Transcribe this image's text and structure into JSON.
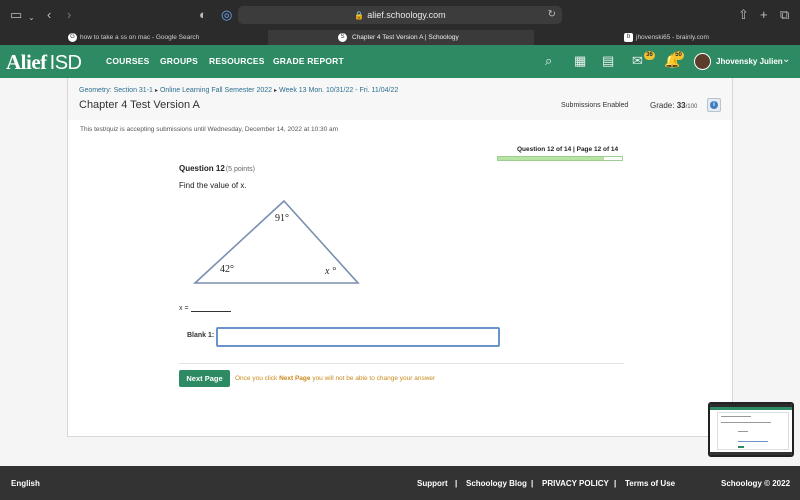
{
  "browser": {
    "url": "alief.schoology.com",
    "tabs": [
      {
        "label": "how to take a ss on mac - Google Search",
        "favicon": "G"
      },
      {
        "label": "Chapter 4 Test Version A | Schoology",
        "favicon": "S"
      },
      {
        "label": "jhovenski65 - brainly.com",
        "favicon": "b"
      }
    ]
  },
  "header": {
    "logo_main": "Alief",
    "logo_suffix": "ISD",
    "nav": [
      "COURSES",
      "GROUPS",
      "RESOURCES",
      "GRADE REPORT"
    ],
    "messages_badge": "36",
    "notifications_badge": "50",
    "user_name": "Jhovensky Julien"
  },
  "page": {
    "breadcrumb": [
      "Geometry: Section 31-1",
      "Online Learning Fall Semester 2022",
      "Week 13 Mon. 10/31/22 - Fri. 11/04/22"
    ],
    "title": "Chapter 4 Test Version A",
    "submissions": "Submissions Enabled",
    "grade_label": "Grade:",
    "grade_score": "33",
    "grade_out_of": "/100",
    "availability": "This test/quiz is accepting submissions until Wednesday, December 14, 2022 at 10:30 am",
    "progress_label": "Question 12 of 14 | Page 12 of 14",
    "progress_fraction": 0.857
  },
  "question": {
    "title": "Question 12",
    "points": "(5 points)",
    "prompt": "Find the value of x.",
    "angle_top": "91°",
    "angle_left": "42°",
    "angle_right": "x °",
    "answer_prefix": "x =",
    "blank_label": "Blank 1:",
    "blank_value": ""
  },
  "actions": {
    "next_label": "Next Page",
    "note_before": "Once you click ",
    "note_link": "Next Page",
    "note_after": " you will not be able to change your answer"
  },
  "footer": {
    "language": "English",
    "links": [
      "Support",
      "Schoology Blog",
      "PRIVACY POLICY",
      "Terms of Use"
    ],
    "copyright": "Schoology © 2022"
  },
  "colors": {
    "brand_green": "#2d8a63",
    "link_blue": "#2d6f8f",
    "warning_orange": "#c98a1e"
  }
}
